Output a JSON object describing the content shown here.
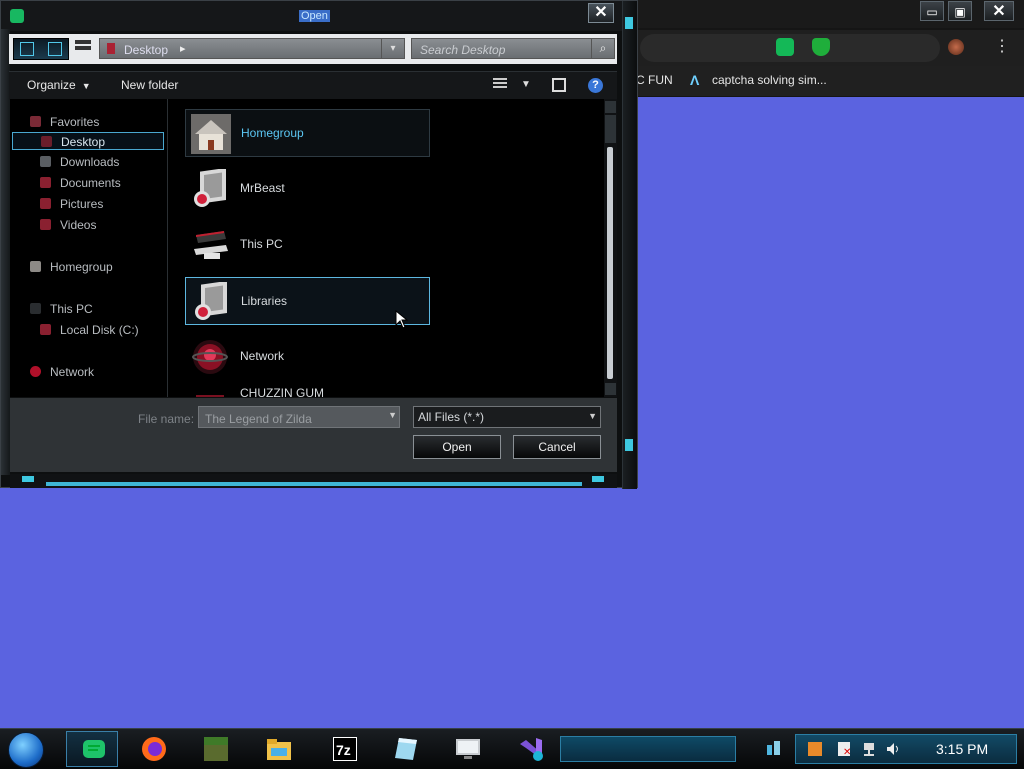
{
  "colors": {
    "desktop": "#5b63e0",
    "accent_cyan": "#5bc6f2",
    "dialog_bg": "#000000",
    "title_highlight": "#3a6ec8"
  },
  "browser": {
    "bookmarks": [
      {
        "label": "C FUN"
      },
      {
        "label": "captcha solving sim...",
        "icon": "triangle-logo-icon"
      }
    ],
    "window_buttons": {
      "restore": "▭",
      "maximize": "▣",
      "close": "✕"
    },
    "menu_icon": "⋮"
  },
  "dialog": {
    "title": "Open",
    "close_symbol": "✕",
    "breadcrumb": {
      "location": "Desktop",
      "chevron": "▸",
      "dropdown": "▾"
    },
    "search": {
      "placeholder": "Search Desktop",
      "icon": "⌕"
    },
    "toolbar": {
      "organize": "Organize",
      "organize_caret": "▼",
      "new_folder": "New folder",
      "more_caret": "▼",
      "help": "?"
    },
    "sidebar": {
      "items": [
        {
          "label": "Favorites",
          "icon": "star-icon"
        },
        {
          "label": "Desktop",
          "icon": "desktop-icon",
          "selected": true
        },
        {
          "label": "Downloads",
          "icon": "downloads-icon"
        },
        {
          "label": "Documents",
          "icon": "documents-icon"
        },
        {
          "label": "Pictures",
          "icon": "pictures-icon"
        },
        {
          "label": "Videos",
          "icon": "videos-icon"
        },
        {
          "label": "Homegroup",
          "icon": "homegroup-icon"
        },
        {
          "label": "This PC",
          "icon": "computer-icon"
        },
        {
          "label": "Local Disk (C:)",
          "icon": "disk-icon"
        },
        {
          "label": "Network",
          "icon": "network-icon"
        }
      ]
    },
    "files": [
      {
        "name": "Homegroup",
        "icon": "house-icon",
        "state": "highlight"
      },
      {
        "name": "MrBeast",
        "icon": "user-folder-icon"
      },
      {
        "name": "This PC",
        "icon": "computer-icon"
      },
      {
        "name": "Libraries",
        "icon": "libraries-icon",
        "state": "selected"
      },
      {
        "name": "Network",
        "icon": "network-globe-icon"
      },
      {
        "name": "CHUZZIN GUM",
        "icon": "folder-icon"
      }
    ],
    "file_name": {
      "label": "File name:",
      "value": "The Legend of Zilda",
      "dropdown": "▼"
    },
    "file_type": {
      "value": "All Files (*.*)",
      "dropdown": "▼"
    },
    "buttons": {
      "open": "Open",
      "cancel": "Cancel"
    }
  },
  "taskbar": {
    "apps": [
      {
        "name": "messenger-app",
        "icon": "chat-bubble-icon",
        "active": true
      },
      {
        "name": "firefox",
        "icon": "firefox-icon"
      },
      {
        "name": "minecraft",
        "icon": "grass-block-icon"
      },
      {
        "name": "file-explorer",
        "icon": "folder-icon"
      },
      {
        "name": "7-zip",
        "icon": "7z-icon",
        "text": "7z"
      },
      {
        "name": "notepad",
        "icon": "notepad-icon"
      },
      {
        "name": "task-manager",
        "icon": "monitor-icon"
      },
      {
        "name": "visual-studio-installer",
        "icon": "visual-studio-icon"
      }
    ],
    "clock": "3:15 PM"
  }
}
